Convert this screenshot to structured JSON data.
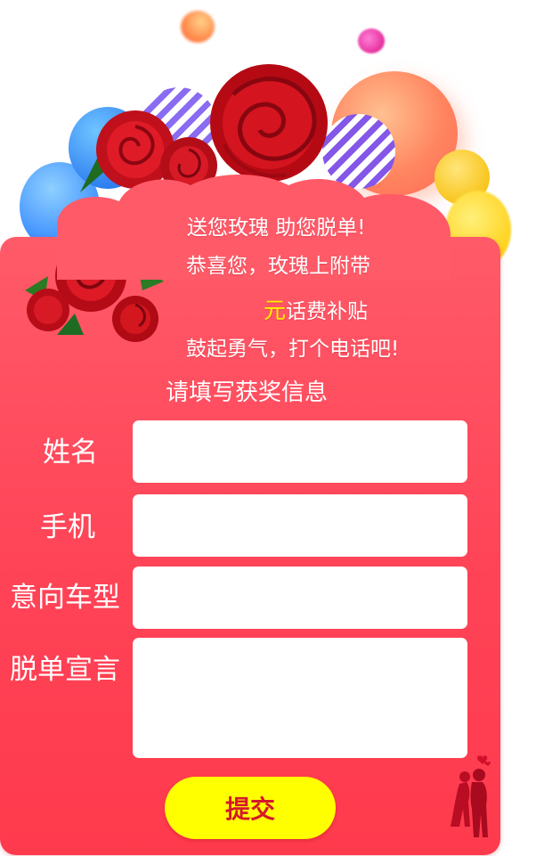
{
  "promo": {
    "line1": "送您玫瑰 助您脱单!",
    "line2": "恭喜您，玫瑰上附带",
    "amount_unit": "元",
    "line3_suffix": "话费补贴",
    "line4": "鼓起勇气，打个电话吧!"
  },
  "form": {
    "title": "请填写获奖信息",
    "name_label": "姓名",
    "phone_label": "手机",
    "car_label": "意向车型",
    "declaration_label": "脱单宣言",
    "name_value": "",
    "phone_value": "",
    "car_value": "",
    "declaration_value": "",
    "submit_label": "提交"
  },
  "icons": {
    "hero_flower": "rose-bouquet-icon",
    "card_flower": "rose-bouquet-icon",
    "corner": "couple-silhouette-icon"
  },
  "colors": {
    "card": "#ff4357",
    "highlight": "#fff200",
    "button": "#ffff00",
    "button_text": "#d4192b"
  }
}
